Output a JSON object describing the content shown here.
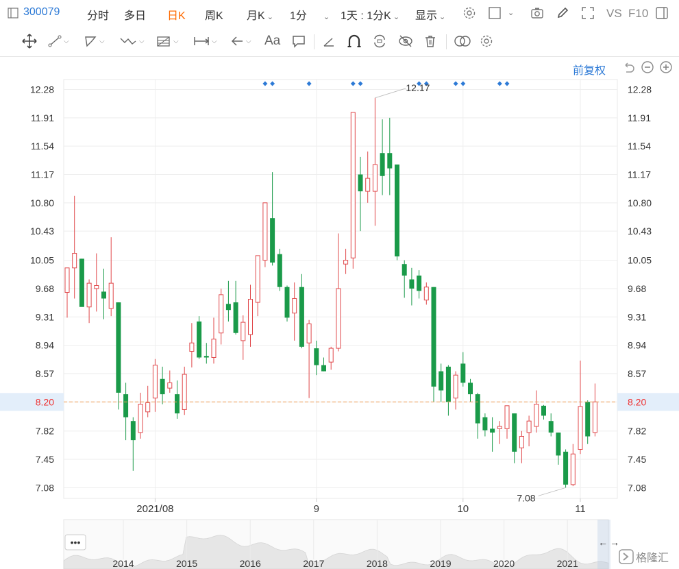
{
  "topbar": {
    "code": "300079",
    "items": [
      "分时",
      "多日",
      "日K",
      "周K",
      "月K",
      "1分",
      "1天 : 1分K",
      "显示"
    ],
    "active_index": 2,
    "vs_label": "VS",
    "f10_label": "F10"
  },
  "toolbar": {
    "font_label": "Aa"
  },
  "chart_options": {
    "fuquan_label": "前复权"
  },
  "navigator": {
    "years": [
      "2014",
      "2015",
      "2016",
      "2017",
      "2018",
      "2019",
      "2020",
      "2021"
    ],
    "dots_label": "•••"
  },
  "watermark": {
    "text": "格隆汇"
  },
  "chart_data": {
    "type": "candlestick",
    "title": "",
    "x_tick_labels": [
      "2021/08",
      "9",
      "10",
      "11"
    ],
    "x_tick_index": [
      12,
      34,
      54,
      70
    ],
    "y_ticks": [
      12.28,
      11.91,
      11.54,
      11.17,
      10.8,
      10.43,
      10.05,
      9.68,
      9.31,
      8.94,
      8.57,
      8.2,
      7.82,
      7.45,
      7.08
    ],
    "ylim": [
      6.94,
      12.41
    ],
    "current_price": 8.2,
    "high_annotation": "12.17",
    "low_annotation": "7.08",
    "high_index": 42,
    "low_index": 68,
    "event_marker_indices": [
      27,
      28,
      33,
      39,
      40,
      48,
      49,
      53,
      54,
      59,
      60
    ],
    "colors": {
      "up": "#e0474a",
      "down": "#1a9a49",
      "current_line": "#f0a05a",
      "event": "#2d7ad6"
    },
    "candles": [
      {
        "o": 9.63,
        "h": 9.95,
        "l": 9.3,
        "c": 9.95
      },
      {
        "o": 9.95,
        "h": 10.89,
        "l": 9.55,
        "c": 10.14
      },
      {
        "o": 10.07,
        "h": 10.07,
        "l": 9.46,
        "c": 9.44
      },
      {
        "o": 9.44,
        "h": 9.8,
        "l": 9.23,
        "c": 9.75
      },
      {
        "o": 9.68,
        "h": 10.14,
        "l": 9.38,
        "c": 9.72
      },
      {
        "o": 9.64,
        "h": 9.94,
        "l": 9.28,
        "c": 9.55
      },
      {
        "o": 9.42,
        "h": 10.35,
        "l": 9.32,
        "c": 9.75
      },
      {
        "o": 9.5,
        "h": 9.5,
        "l": 8.1,
        "c": 8.32
      },
      {
        "o": 8.3,
        "h": 8.45,
        "l": 7.7,
        "c": 8.0
      },
      {
        "o": 7.95,
        "h": 8.0,
        "l": 7.3,
        "c": 7.7
      },
      {
        "o": 7.8,
        "h": 8.32,
        "l": 7.72,
        "c": 8.17
      },
      {
        "o": 8.07,
        "h": 8.41,
        "l": 8.0,
        "c": 8.19
      },
      {
        "o": 8.25,
        "h": 8.76,
        "l": 8.07,
        "c": 8.68
      },
      {
        "o": 8.5,
        "h": 8.66,
        "l": 8.17,
        "c": 8.3
      },
      {
        "o": 8.38,
        "h": 8.61,
        "l": 8.32,
        "c": 8.45
      },
      {
        "o": 8.3,
        "h": 8.48,
        "l": 7.98,
        "c": 8.05
      },
      {
        "o": 8.1,
        "h": 8.66,
        "l": 8.03,
        "c": 8.56
      },
      {
        "o": 8.86,
        "h": 9.23,
        "l": 8.65,
        "c": 8.97
      },
      {
        "o": 9.25,
        "h": 9.32,
        "l": 8.76,
        "c": 8.78
      },
      {
        "o": 8.8,
        "h": 8.97,
        "l": 8.7,
        "c": 8.78
      },
      {
        "o": 8.78,
        "h": 9.3,
        "l": 8.7,
        "c": 9.02
      },
      {
        "o": 9.1,
        "h": 9.68,
        "l": 8.95,
        "c": 9.6
      },
      {
        "o": 9.48,
        "h": 9.78,
        "l": 9.25,
        "c": 9.4
      },
      {
        "o": 9.5,
        "h": 9.78,
        "l": 9.08,
        "c": 9.1
      },
      {
        "o": 9.0,
        "h": 9.33,
        "l": 8.75,
        "c": 9.24
      },
      {
        "o": 9.08,
        "h": 9.73,
        "l": 8.92,
        "c": 9.54
      },
      {
        "o": 9.5,
        "h": 10.11,
        "l": 9.32,
        "c": 10.11
      },
      {
        "o": 10.05,
        "h": 10.8,
        "l": 9.96,
        "c": 10.8
      },
      {
        "o": 10.6,
        "h": 11.2,
        "l": 9.98,
        "c": 10.02
      },
      {
        "o": 10.13,
        "h": 10.2,
        "l": 9.65,
        "c": 9.7
      },
      {
        "o": 9.7,
        "h": 9.72,
        "l": 9.25,
        "c": 9.3
      },
      {
        "o": 9.36,
        "h": 9.76,
        "l": 9.0,
        "c": 9.55
      },
      {
        "o": 9.7,
        "h": 9.87,
        "l": 8.9,
        "c": 8.92
      },
      {
        "o": 8.97,
        "h": 9.27,
        "l": 8.25,
        "c": 9.22
      },
      {
        "o": 8.9,
        "h": 9.0,
        "l": 8.55,
        "c": 8.68
      },
      {
        "o": 8.68,
        "h": 8.78,
        "l": 8.6,
        "c": 8.6
      },
      {
        "o": 8.72,
        "h": 8.92,
        "l": 8.62,
        "c": 8.9
      },
      {
        "o": 8.9,
        "h": 10.4,
        "l": 8.86,
        "c": 9.68
      },
      {
        "o": 10.0,
        "h": 10.2,
        "l": 9.87,
        "c": 10.05
      },
      {
        "o": 10.08,
        "h": 11.98,
        "l": 9.94,
        "c": 11.98
      },
      {
        "o": 11.17,
        "h": 11.4,
        "l": 10.43,
        "c": 10.95
      },
      {
        "o": 10.95,
        "h": 11.47,
        "l": 10.8,
        "c": 11.12
      },
      {
        "o": 10.95,
        "h": 12.17,
        "l": 10.5,
        "c": 11.3
      },
      {
        "o": 11.45,
        "h": 11.89,
        "l": 10.9,
        "c": 11.15
      },
      {
        "o": 11.45,
        "h": 11.91,
        "l": 10.9,
        "c": 11.25
      },
      {
        "o": 11.3,
        "h": 11.3,
        "l": 10.05,
        "c": 10.1
      },
      {
        "o": 10.0,
        "h": 10.05,
        "l": 9.56,
        "c": 9.85
      },
      {
        "o": 9.8,
        "h": 9.95,
        "l": 9.46,
        "c": 9.68
      },
      {
        "o": 9.85,
        "h": 9.92,
        "l": 9.55,
        "c": 9.65
      },
      {
        "o": 9.53,
        "h": 9.76,
        "l": 9.47,
        "c": 9.7
      },
      {
        "o": 9.7,
        "h": 9.7,
        "l": 8.2,
        "c": 8.4
      },
      {
        "o": 8.6,
        "h": 8.7,
        "l": 8.2,
        "c": 8.35
      },
      {
        "o": 8.66,
        "h": 8.68,
        "l": 8.02,
        "c": 8.2
      },
      {
        "o": 8.25,
        "h": 8.6,
        "l": 8.1,
        "c": 8.55
      },
      {
        "o": 8.7,
        "h": 8.85,
        "l": 8.4,
        "c": 8.45
      },
      {
        "o": 8.45,
        "h": 8.5,
        "l": 8.2,
        "c": 8.3
      },
      {
        "o": 8.3,
        "h": 8.32,
        "l": 7.72,
        "c": 7.92
      },
      {
        "o": 8.0,
        "h": 8.05,
        "l": 7.75,
        "c": 7.83
      },
      {
        "o": 7.85,
        "h": 8.0,
        "l": 7.55,
        "c": 7.8
      },
      {
        "o": 7.85,
        "h": 7.95,
        "l": 7.65,
        "c": 7.88
      },
      {
        "o": 7.85,
        "h": 8.05,
        "l": 7.72,
        "c": 8.15
      },
      {
        "o": 8.05,
        "h": 8.05,
        "l": 7.4,
        "c": 7.55
      },
      {
        "o": 7.6,
        "h": 7.82,
        "l": 7.4,
        "c": 7.75
      },
      {
        "o": 7.8,
        "h": 8.02,
        "l": 7.62,
        "c": 7.95
      },
      {
        "o": 7.88,
        "h": 8.35,
        "l": 7.8,
        "c": 8.17
      },
      {
        "o": 8.15,
        "h": 8.16,
        "l": 7.97,
        "c": 8.02
      },
      {
        "o": 7.95,
        "h": 8.05,
        "l": 7.75,
        "c": 7.8
      },
      {
        "o": 7.8,
        "h": 7.8,
        "l": 7.38,
        "c": 7.5
      },
      {
        "o": 7.55,
        "h": 7.58,
        "l": 7.08,
        "c": 7.12
      },
      {
        "o": 7.12,
        "h": 7.65,
        "l": 7.1,
        "c": 7.52
      },
      {
        "o": 7.58,
        "h": 8.74,
        "l": 7.52,
        "c": 8.14
      },
      {
        "o": 8.2,
        "h": 8.22,
        "l": 7.65,
        "c": 7.75
      },
      {
        "o": 7.8,
        "h": 8.44,
        "l": 7.75,
        "c": 8.2
      }
    ]
  }
}
